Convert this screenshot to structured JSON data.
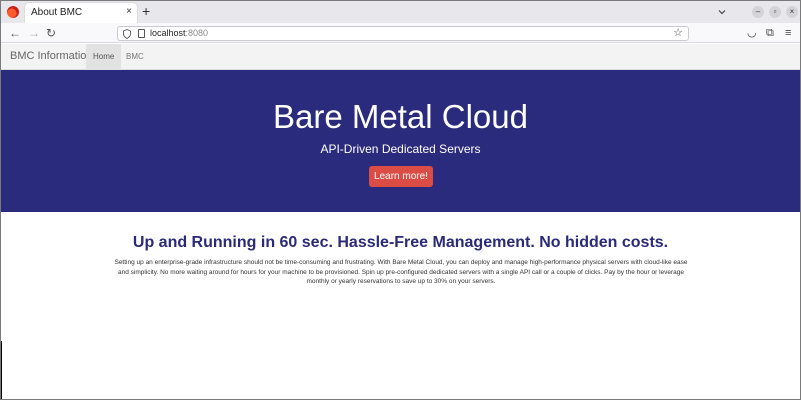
{
  "browser": {
    "tab_title": "About BMC",
    "tab_close": "×",
    "new_tab": "+",
    "url_host": "localhost",
    "url_port": ":8080",
    "icons": [
      "firefox-icon",
      "back-icon",
      "forward-icon",
      "reload-icon",
      "shield-icon",
      "page-icon",
      "star-icon",
      "pocket-icon",
      "extensions-icon",
      "menu-icon",
      "minimize-icon",
      "restore-icon",
      "close-icon"
    ]
  },
  "site_nav": {
    "brand": "BMC Information",
    "links": [
      {
        "label": "Home",
        "active": true
      },
      {
        "label": "BMC",
        "active": false
      }
    ]
  },
  "hero": {
    "title": "Bare Metal Cloud",
    "subtitle": "API-Driven Dedicated Servers",
    "button_label": "Learn more!",
    "bg_color": "#2b2b7d",
    "button_color": "#db4d44"
  },
  "content": {
    "headline": "Up and Running in 60 sec. Hassle-Free Management. No hidden costs.",
    "paragraph": "Setting up an enterprise-grade infrastructure should not be time-consuming and frustrating. With Bare Metal Cloud, you can deploy and manage high-performance physical servers with cloud-like ease and simplicity. No more waiting around for hours for your machine to be provisioned. Spin up pre-configured dedicated servers with a single API call or a couple of clicks. Pay by the hour or leverage monthly or yearly reservations to save up to 30% on your servers.",
    "headline_color": "#2a2a78"
  }
}
